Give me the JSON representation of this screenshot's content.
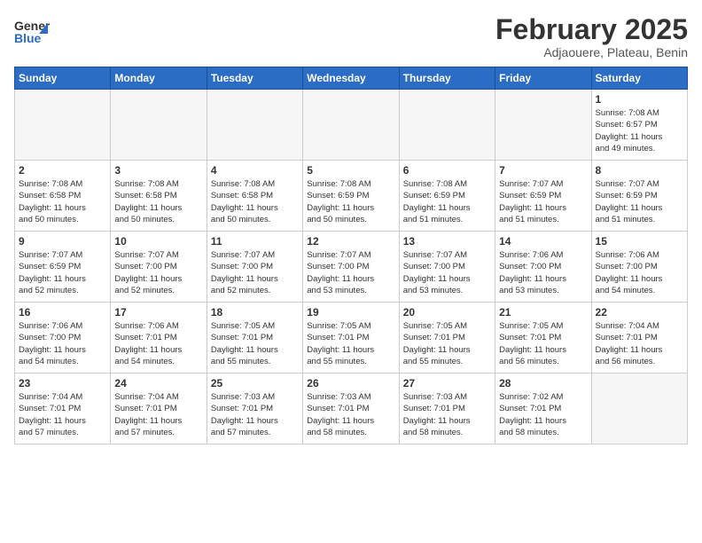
{
  "header": {
    "logo_general": "General",
    "logo_blue": "Blue",
    "month_title": "February 2025",
    "subtitle": "Adjaouere, Plateau, Benin"
  },
  "weekdays": [
    "Sunday",
    "Monday",
    "Tuesday",
    "Wednesday",
    "Thursday",
    "Friday",
    "Saturday"
  ],
  "weeks": [
    [
      {
        "day": "",
        "info": ""
      },
      {
        "day": "",
        "info": ""
      },
      {
        "day": "",
        "info": ""
      },
      {
        "day": "",
        "info": ""
      },
      {
        "day": "",
        "info": ""
      },
      {
        "day": "",
        "info": ""
      },
      {
        "day": "1",
        "info": "Sunrise: 7:08 AM\nSunset: 6:57 PM\nDaylight: 11 hours\nand 49 minutes."
      }
    ],
    [
      {
        "day": "2",
        "info": "Sunrise: 7:08 AM\nSunset: 6:58 PM\nDaylight: 11 hours\nand 50 minutes."
      },
      {
        "day": "3",
        "info": "Sunrise: 7:08 AM\nSunset: 6:58 PM\nDaylight: 11 hours\nand 50 minutes."
      },
      {
        "day": "4",
        "info": "Sunrise: 7:08 AM\nSunset: 6:58 PM\nDaylight: 11 hours\nand 50 minutes."
      },
      {
        "day": "5",
        "info": "Sunrise: 7:08 AM\nSunset: 6:59 PM\nDaylight: 11 hours\nand 50 minutes."
      },
      {
        "day": "6",
        "info": "Sunrise: 7:08 AM\nSunset: 6:59 PM\nDaylight: 11 hours\nand 51 minutes."
      },
      {
        "day": "7",
        "info": "Sunrise: 7:07 AM\nSunset: 6:59 PM\nDaylight: 11 hours\nand 51 minutes."
      },
      {
        "day": "8",
        "info": "Sunrise: 7:07 AM\nSunset: 6:59 PM\nDaylight: 11 hours\nand 51 minutes."
      }
    ],
    [
      {
        "day": "9",
        "info": "Sunrise: 7:07 AM\nSunset: 6:59 PM\nDaylight: 11 hours\nand 52 minutes."
      },
      {
        "day": "10",
        "info": "Sunrise: 7:07 AM\nSunset: 7:00 PM\nDaylight: 11 hours\nand 52 minutes."
      },
      {
        "day": "11",
        "info": "Sunrise: 7:07 AM\nSunset: 7:00 PM\nDaylight: 11 hours\nand 52 minutes."
      },
      {
        "day": "12",
        "info": "Sunrise: 7:07 AM\nSunset: 7:00 PM\nDaylight: 11 hours\nand 53 minutes."
      },
      {
        "day": "13",
        "info": "Sunrise: 7:07 AM\nSunset: 7:00 PM\nDaylight: 11 hours\nand 53 minutes."
      },
      {
        "day": "14",
        "info": "Sunrise: 7:06 AM\nSunset: 7:00 PM\nDaylight: 11 hours\nand 53 minutes."
      },
      {
        "day": "15",
        "info": "Sunrise: 7:06 AM\nSunset: 7:00 PM\nDaylight: 11 hours\nand 54 minutes."
      }
    ],
    [
      {
        "day": "16",
        "info": "Sunrise: 7:06 AM\nSunset: 7:00 PM\nDaylight: 11 hours\nand 54 minutes."
      },
      {
        "day": "17",
        "info": "Sunrise: 7:06 AM\nSunset: 7:01 PM\nDaylight: 11 hours\nand 54 minutes."
      },
      {
        "day": "18",
        "info": "Sunrise: 7:05 AM\nSunset: 7:01 PM\nDaylight: 11 hours\nand 55 minutes."
      },
      {
        "day": "19",
        "info": "Sunrise: 7:05 AM\nSunset: 7:01 PM\nDaylight: 11 hours\nand 55 minutes."
      },
      {
        "day": "20",
        "info": "Sunrise: 7:05 AM\nSunset: 7:01 PM\nDaylight: 11 hours\nand 55 minutes."
      },
      {
        "day": "21",
        "info": "Sunrise: 7:05 AM\nSunset: 7:01 PM\nDaylight: 11 hours\nand 56 minutes."
      },
      {
        "day": "22",
        "info": "Sunrise: 7:04 AM\nSunset: 7:01 PM\nDaylight: 11 hours\nand 56 minutes."
      }
    ],
    [
      {
        "day": "23",
        "info": "Sunrise: 7:04 AM\nSunset: 7:01 PM\nDaylight: 11 hours\nand 57 minutes."
      },
      {
        "day": "24",
        "info": "Sunrise: 7:04 AM\nSunset: 7:01 PM\nDaylight: 11 hours\nand 57 minutes."
      },
      {
        "day": "25",
        "info": "Sunrise: 7:03 AM\nSunset: 7:01 PM\nDaylight: 11 hours\nand 57 minutes."
      },
      {
        "day": "26",
        "info": "Sunrise: 7:03 AM\nSunset: 7:01 PM\nDaylight: 11 hours\nand 58 minutes."
      },
      {
        "day": "27",
        "info": "Sunrise: 7:03 AM\nSunset: 7:01 PM\nDaylight: 11 hours\nand 58 minutes."
      },
      {
        "day": "28",
        "info": "Sunrise: 7:02 AM\nSunset: 7:01 PM\nDaylight: 11 hours\nand 58 minutes."
      },
      {
        "day": "",
        "info": ""
      }
    ]
  ]
}
